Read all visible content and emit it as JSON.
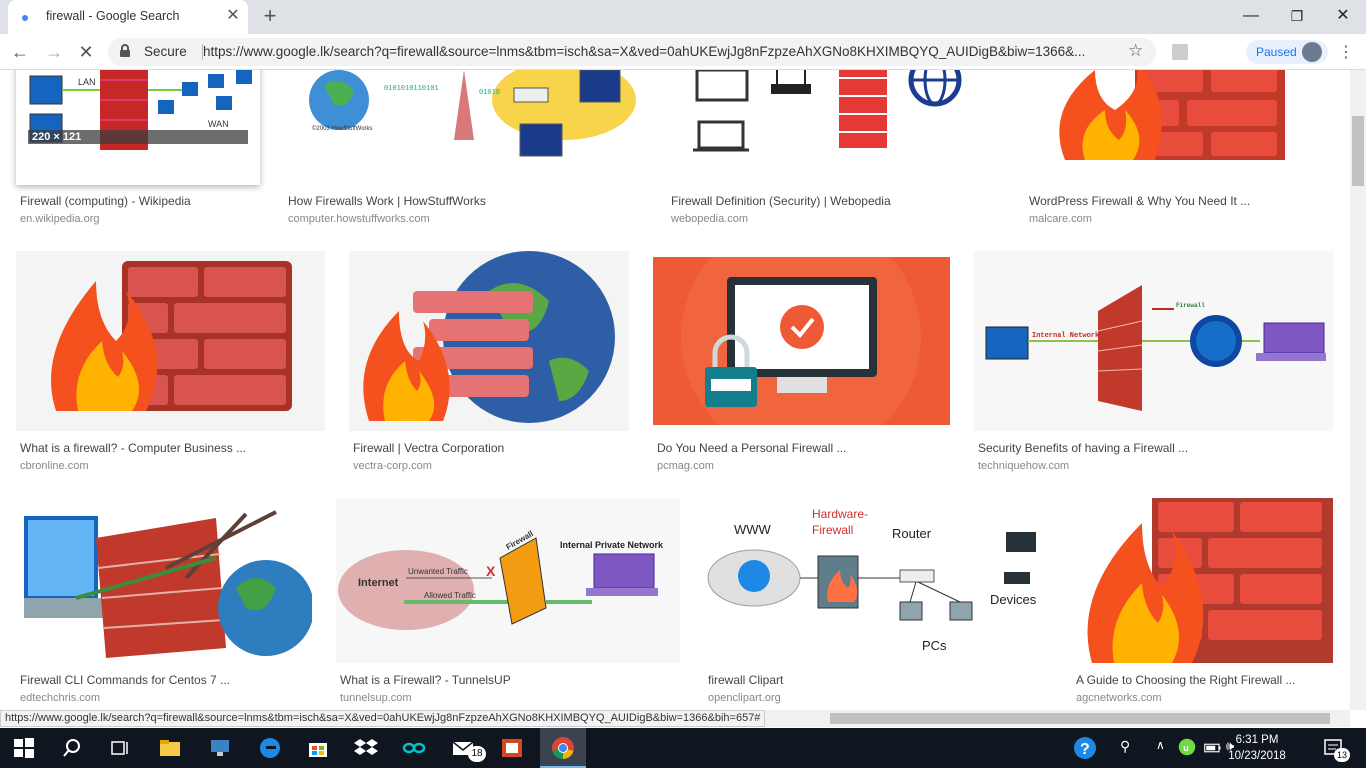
{
  "browser": {
    "tab_title": "firewall - Google Search",
    "tab_close": "✕",
    "new_tab": "+",
    "win_minimize": "—",
    "win_maximize": "❐",
    "win_close": "✕",
    "secure_label": "Secure",
    "url": "https://www.google.lk/search?q=firewall&source=lnms&tbm=isch&sa=X&ved=0ahUKEwjJg8nFzpzeAhXGNo8KHXIMBQYQ_AUIDigB&biw=1366&...",
    "profile_status": "Paused",
    "status_url": "https://www.google.lk/search?q=firewall&source=lnms&tbm=isch&sa=X&ved=0ahUKEwjJg8nFzpzeAhXGNo8KHXIMBQYQ_AUIDigB&biw=1366&bih=657#"
  },
  "results": [
    {
      "title": "Firewall (computing) - Wikipedia",
      "source": "en.wikipedia.org",
      "badge": "220 × 121"
    },
    {
      "title": "How Firewalls Work | HowStuffWorks",
      "source": "computer.howstuffworks.com"
    },
    {
      "title": "Firewall Definition (Security) | Webopedia",
      "source": "webopedia.com"
    },
    {
      "title": "WordPress Firewall & Why You Need It ...",
      "source": "malcare.com"
    },
    {
      "title": "What is a firewall? - Computer Business ...",
      "source": "cbronline.com"
    },
    {
      "title": "Firewall | Vectra Corporation",
      "source": "vectra-corp.com"
    },
    {
      "title": "Do You Need a Personal Firewall ...",
      "source": "pcmag.com"
    },
    {
      "title": "Security Benefits of having a Firewall ...",
      "source": "techniquehow.com"
    },
    {
      "title": "Firewall CLI Commands for Centos 7 ...",
      "source": "edtechchris.com"
    },
    {
      "title": "What is a Firewall? - TunnelsUP",
      "source": "tunnelsup.com"
    },
    {
      "title": "firewall Clipart",
      "source": "openclipart.org"
    },
    {
      "title": "A Guide to Choosing the Right Firewall ...",
      "source": "agcnetworks.com"
    }
  ],
  "image_labels": {
    "lan": "LAN",
    "wan": "WAN",
    "firewall_small": "Firewall",
    "www": "WWW",
    "hw_firewall_1": "Hardware-",
    "hw_firewall_2": "Firewall",
    "router": "Router",
    "devices": "Devices",
    "pcs": "PCs",
    "internet": "Internet",
    "unwanted": "Unwanted Traffic",
    "allowed": "Allowed Traffic",
    "internal_private": "Internal Private Network",
    "firewall_diag": "Firewall",
    "internal_network": "Internal Network",
    "fw_label": "Firewall",
    "howstuff_copy": "©2003 HowStuffWorks"
  },
  "taskbar": {
    "time": "6:31 PM",
    "date": "10/23/2018",
    "mail_count": "18",
    "notif_count": "13"
  }
}
